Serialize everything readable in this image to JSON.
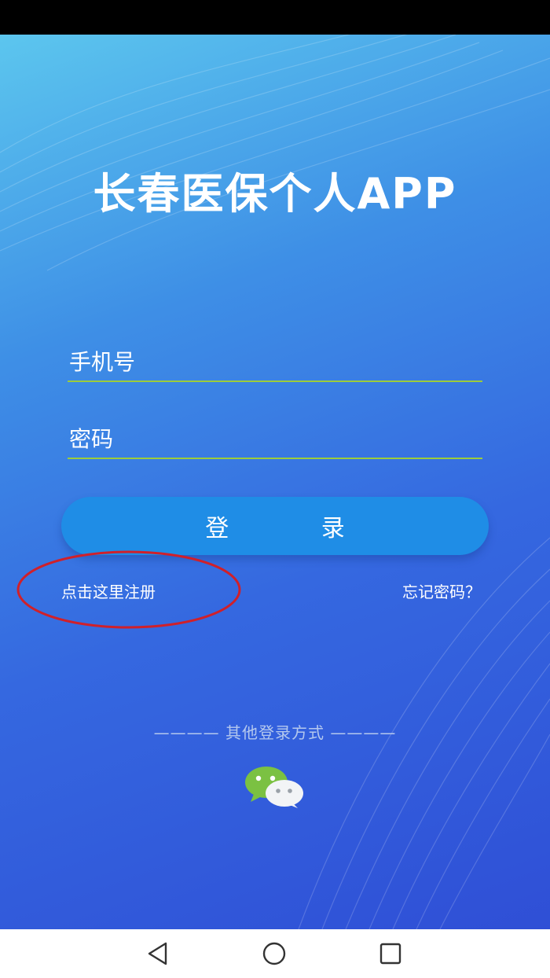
{
  "app": {
    "title": "长春医保个人APP"
  },
  "login": {
    "phone_placeholder": "手机号",
    "password_placeholder": "密码",
    "submit_label": "登 录",
    "register_link": "点击这里注册",
    "forgot_password_link": "忘记密码？"
  },
  "other_login": {
    "label": "———— 其他登录方式 ————",
    "wechat_icon": "wechat-icon"
  },
  "navigation": {
    "back_icon": "back-triangle-icon",
    "home_icon": "home-circle-icon",
    "recent_icon": "recent-apps-square-icon"
  },
  "colors": {
    "gradient_top": "#5cc6ee",
    "gradient_bottom": "#2f4fd6",
    "button": "#1f8de6",
    "input_underline": "#9ccc3c",
    "annotation": "#d0202a",
    "wechat_green": "#7bc142"
  }
}
